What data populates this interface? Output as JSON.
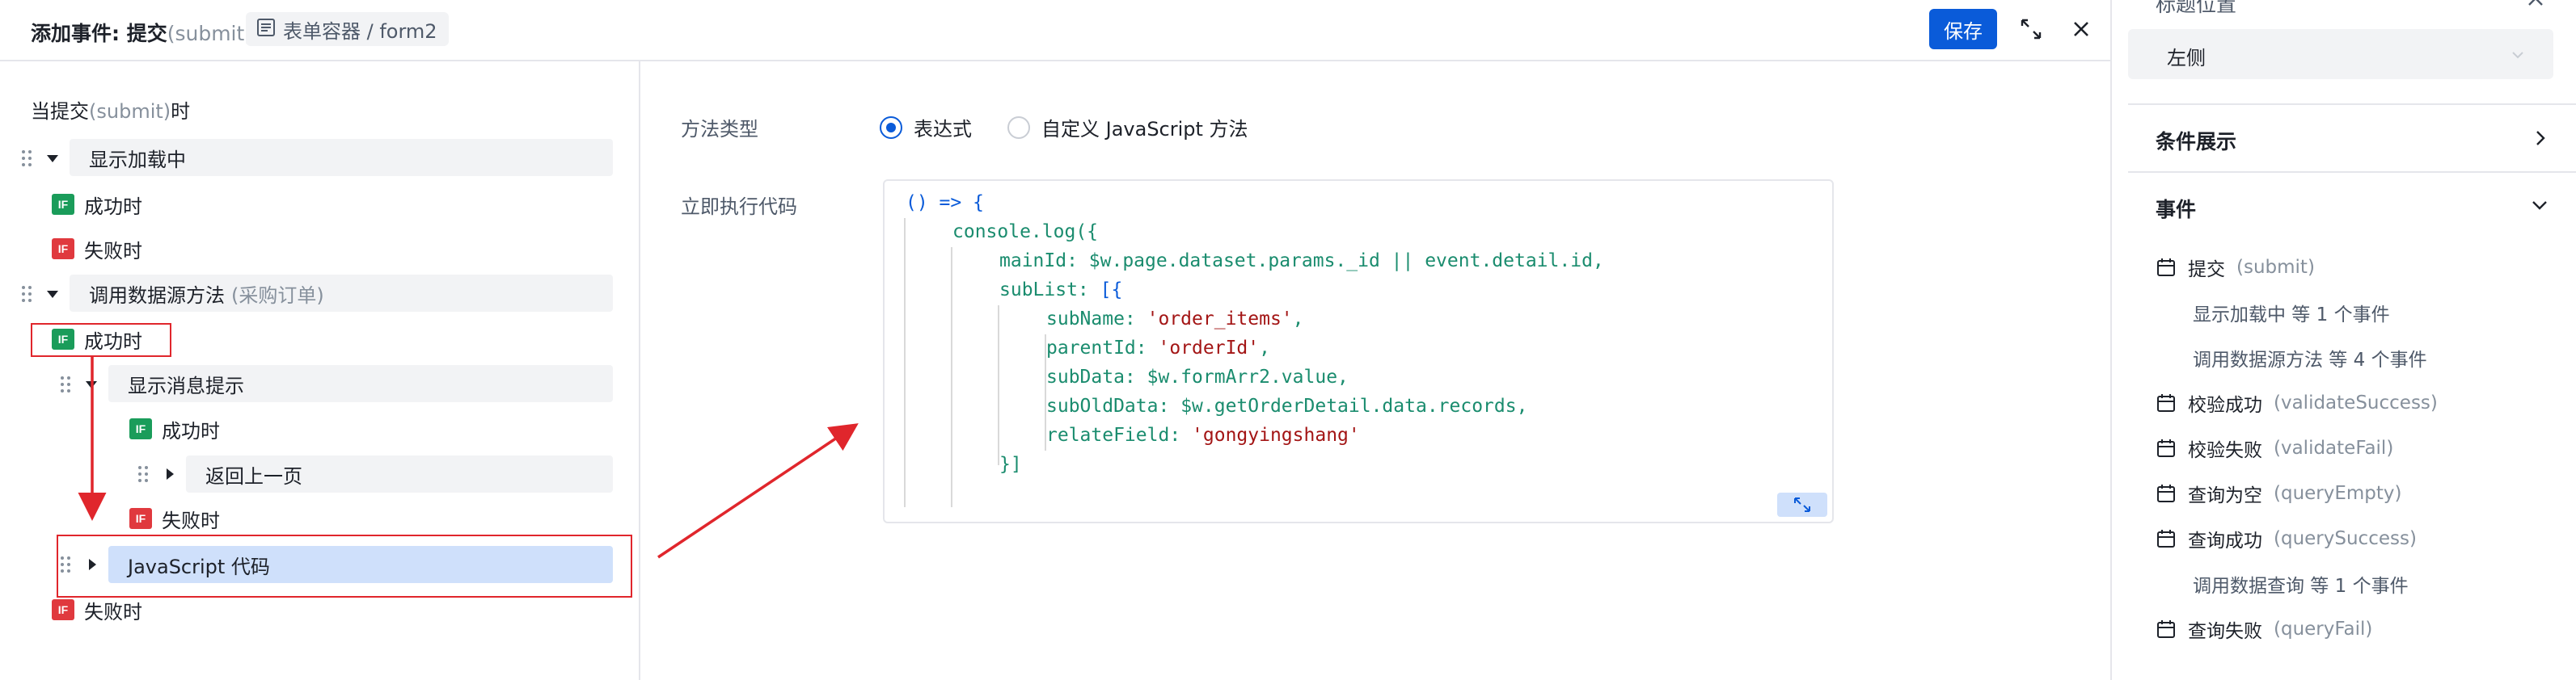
{
  "header": {
    "title_prefix": "添加事件: 提交",
    "title_code": "(submit)",
    "context_label": "表单容器 / form2",
    "save_label": "保存"
  },
  "left": {
    "trigger_prefix": "当提交",
    "trigger_code": "(submit)",
    "trigger_suffix": "时",
    "action_loading": "显示加载中",
    "on_success": "成功时",
    "on_fail": "失败时",
    "action_datasource": "调用数据源方法",
    "action_datasource_sub": "(采购订单)",
    "action_message": "显示消息提示",
    "action_back": "返回上一页",
    "action_js": "JavaScript 代码",
    "badge": "IF"
  },
  "form": {
    "method_type_label": "方法类型",
    "option_expression": "表达式",
    "option_custom_js": "自定义 JavaScript 方法",
    "selected_option": "表达式",
    "code_label": "立即执行代码"
  },
  "code": {
    "l1a": "() => {",
    "l2a": "console.log({",
    "l3a": "mainId:",
    "l3b": "$w.page.dataset.params._id || event.detail.id,",
    "l4a": "subList:",
    "l4b": "[{",
    "l5a": "subName:",
    "l5b": "'order_items'",
    "l5c": ",",
    "l6a": "parentId:",
    "l6b": "'orderId'",
    "l6c": ",",
    "l7a": "subData:",
    "l7b": "$w.formArr2.value,",
    "l8a": "subOldData:",
    "l8b": "$w.getOrderDetail.data.records,",
    "l9a": "relateField:",
    "l9b": "'gongyingshang'",
    "l10a": "}]"
  },
  "side": {
    "cut_title": "标题位置",
    "select_value": "左侧",
    "section_condition": "条件展示",
    "section_events": "事件",
    "events": [
      {
        "name": "提交",
        "code": "(submit)"
      },
      {
        "name": "校验成功",
        "code": "(validateSuccess)"
      },
      {
        "name": "校验失败",
        "code": "(validateFail)"
      },
      {
        "name": "查询为空",
        "code": "(queryEmpty)"
      },
      {
        "name": "查询成功",
        "code": "(querySuccess)"
      },
      {
        "name": "查询失败",
        "code": "(queryFail)"
      }
    ],
    "sub_loading": "显示加载中 等 1 个事件",
    "sub_datasource": "调用数据源方法 等 4 个事件",
    "sub_query": "调用数据查询 等 1 个事件"
  },
  "colors": {
    "primary": "#0a5bd9",
    "success_badge": "#1a9c5a",
    "fail_badge": "#e0393e",
    "annotation_red": "#e0262c"
  }
}
